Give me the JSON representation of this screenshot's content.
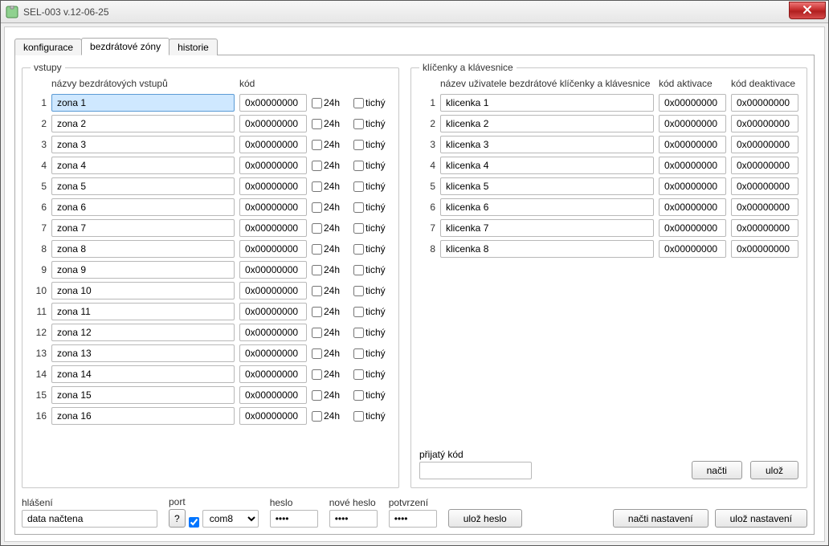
{
  "window": {
    "title": "SEL-003 v.12-06-25"
  },
  "tabs": [
    {
      "label": "konfigurace"
    },
    {
      "label": "bezdrátové zóny"
    },
    {
      "label": "historie"
    }
  ],
  "inputs_group": {
    "legend": "vstupy",
    "hdr_name": "názvy bezdrátových vstupů",
    "hdr_code": "kód",
    "chk24h": "24h",
    "chk_silent": "tichý",
    "rows": [
      {
        "idx": "1",
        "name": "zona 1",
        "code": "0x00000000",
        "h24": false,
        "silent": false
      },
      {
        "idx": "2",
        "name": "zona 2",
        "code": "0x00000000",
        "h24": false,
        "silent": false
      },
      {
        "idx": "3",
        "name": "zona 3",
        "code": "0x00000000",
        "h24": false,
        "silent": false
      },
      {
        "idx": "4",
        "name": "zona 4",
        "code": "0x00000000",
        "h24": false,
        "silent": false
      },
      {
        "idx": "5",
        "name": "zona 5",
        "code": "0x00000000",
        "h24": false,
        "silent": false
      },
      {
        "idx": "6",
        "name": "zona 6",
        "code": "0x00000000",
        "h24": false,
        "silent": false
      },
      {
        "idx": "7",
        "name": "zona 7",
        "code": "0x00000000",
        "h24": false,
        "silent": false
      },
      {
        "idx": "8",
        "name": "zona 8",
        "code": "0x00000000",
        "h24": false,
        "silent": false
      },
      {
        "idx": "9",
        "name": "zona 9",
        "code": "0x00000000",
        "h24": false,
        "silent": false
      },
      {
        "idx": "10",
        "name": "zona 10",
        "code": "0x00000000",
        "h24": false,
        "silent": false
      },
      {
        "idx": "11",
        "name": "zona 11",
        "code": "0x00000000",
        "h24": false,
        "silent": false
      },
      {
        "idx": "12",
        "name": "zona 12",
        "code": "0x00000000",
        "h24": false,
        "silent": false
      },
      {
        "idx": "13",
        "name": "zona 13",
        "code": "0x00000000",
        "h24": false,
        "silent": false
      },
      {
        "idx": "14",
        "name": "zona 14",
        "code": "0x00000000",
        "h24": false,
        "silent": false
      },
      {
        "idx": "15",
        "name": "zona 15",
        "code": "0x00000000",
        "h24": false,
        "silent": false
      },
      {
        "idx": "16",
        "name": "zona 16",
        "code": "0x00000000",
        "h24": false,
        "silent": false
      }
    ]
  },
  "keyfobs_group": {
    "legend": "klíčenky a klávesnice",
    "hdr_name": "název uživatele bezdrátové klíčenky a klávesnice",
    "hdr_act": "kód aktivace",
    "hdr_deact": "kód deaktivace",
    "rows": [
      {
        "idx": "1",
        "name": "klicenka 1",
        "act": "0x00000000",
        "deact": "0x00000000"
      },
      {
        "idx": "2",
        "name": "klicenka 2",
        "act": "0x00000000",
        "deact": "0x00000000"
      },
      {
        "idx": "3",
        "name": "klicenka 3",
        "act": "0x00000000",
        "deact": "0x00000000"
      },
      {
        "idx": "4",
        "name": "klicenka 4",
        "act": "0x00000000",
        "deact": "0x00000000"
      },
      {
        "idx": "5",
        "name": "klicenka 5",
        "act": "0x00000000",
        "deact": "0x00000000"
      },
      {
        "idx": "6",
        "name": "klicenka 6",
        "act": "0x00000000",
        "deact": "0x00000000"
      },
      {
        "idx": "7",
        "name": "klicenka 7",
        "act": "0x00000000",
        "deact": "0x00000000"
      },
      {
        "idx": "8",
        "name": "klicenka 8",
        "act": "0x00000000",
        "deact": "0x00000000"
      }
    ],
    "received_label": "přijatý kód",
    "received_value": "",
    "btn_read": "načti",
    "btn_save": "ulož"
  },
  "bottom": {
    "status_label": "hlášení",
    "status_value": "data načtena",
    "help_btn": "?",
    "port_label": "port",
    "port_enabled": true,
    "port_value": "com8",
    "pw_label": "heslo",
    "pw_value": "••••",
    "newpw_label": "nové heslo",
    "newpw_value": "••••",
    "confirm_label": "potvrzení",
    "confirm_value": "••••",
    "btn_savepw": "ulož heslo",
    "btn_read_settings": "načti nastavení",
    "btn_save_settings": "ulož nastavení"
  }
}
